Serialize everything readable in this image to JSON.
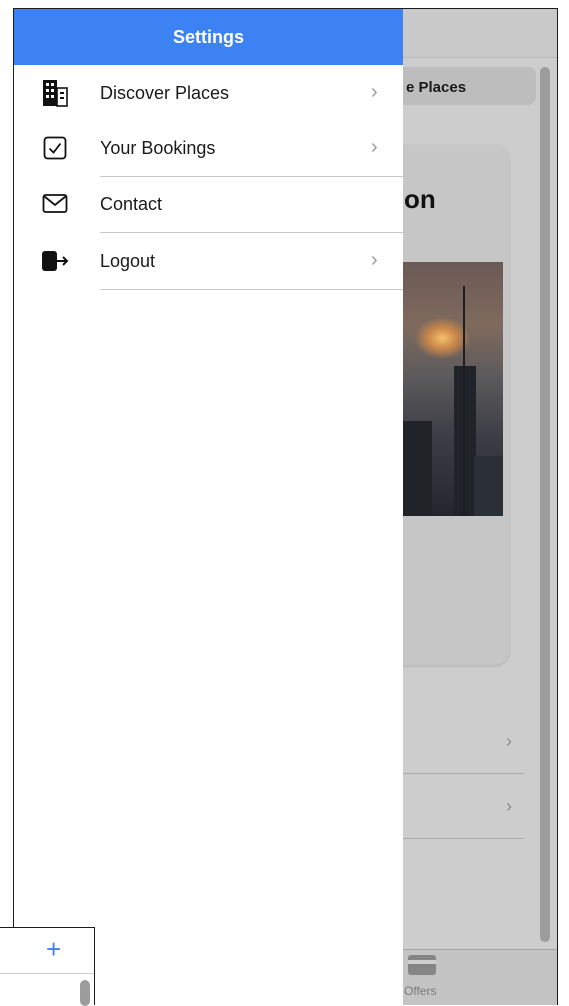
{
  "drawer": {
    "title": "Settings",
    "items": [
      {
        "label": "Discover Places",
        "icon": "building-icon",
        "chevron": "›"
      },
      {
        "label": "Your Bookings",
        "icon": "checkbox-icon",
        "chevron": "›"
      },
      {
        "label": "Contact",
        "icon": "mail-icon",
        "chevron": ""
      },
      {
        "label": "Logout",
        "icon": "logout-icon",
        "chevron": "›"
      }
    ]
  },
  "background": {
    "segment_label": "e Places",
    "card_title": "on",
    "list_chevrons": [
      "›",
      "›"
    ],
    "tab_label": "Offers"
  },
  "mini_window": {
    "plus": "+"
  },
  "colors": {
    "accent": "#3d82f3",
    "drawer_bg": "#ffffff",
    "overlay": "#c9c9c9"
  }
}
